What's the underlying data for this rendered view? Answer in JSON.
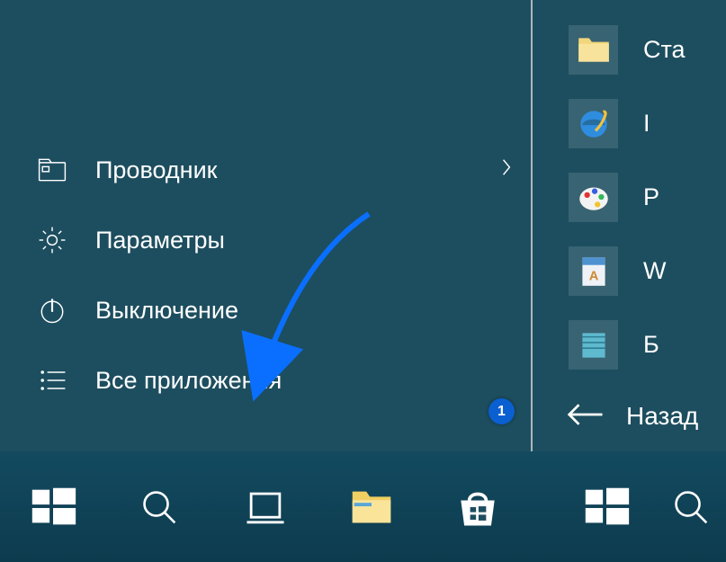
{
  "menu": {
    "explorer": "Проводник",
    "settings": "Параметры",
    "power": "Выключение",
    "all_apps": "Все приложения"
  },
  "right": {
    "items": [
      {
        "label": "Ста"
      },
      {
        "label": "I"
      },
      {
        "label": "P"
      },
      {
        "label": "W"
      },
      {
        "label": "Б"
      }
    ],
    "back": "Назад"
  },
  "badge": "1"
}
